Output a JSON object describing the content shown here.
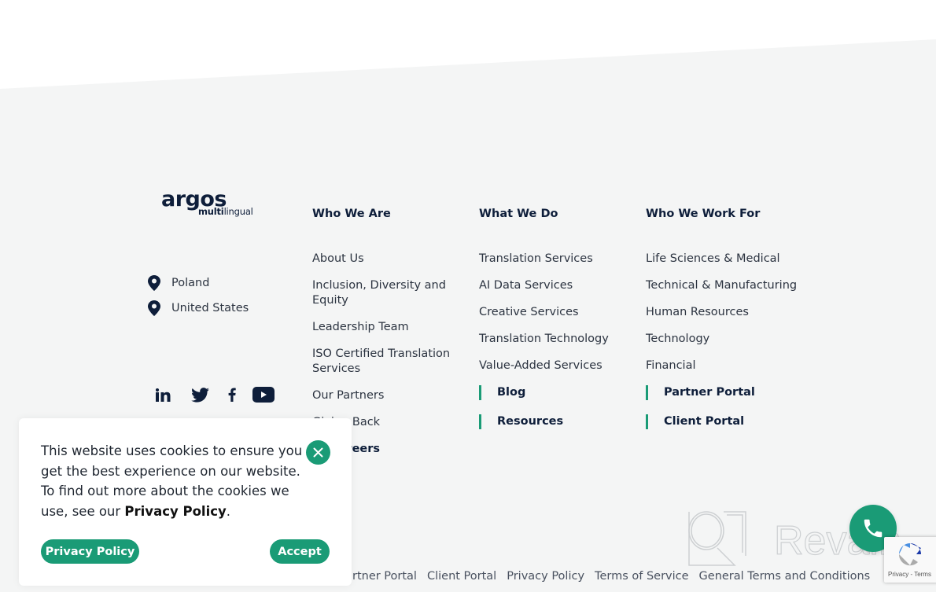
{
  "colors": {
    "accent": "#1a9b76",
    "navy": "#0e1e3a",
    "footer_bg": "#f4f5f5",
    "text": "#2b3340"
  },
  "logo": {
    "word": "argos",
    "sub_bold": "multi",
    "sub_rest": "lingual"
  },
  "locations": [
    {
      "icon": "map-pin-icon",
      "label": "Poland"
    },
    {
      "icon": "map-pin-icon",
      "label": "United States"
    }
  ],
  "socials": [
    {
      "icon": "linkedin-icon",
      "label": "LinkedIn"
    },
    {
      "icon": "twitter-icon",
      "label": "Twitter"
    },
    {
      "icon": "facebook-icon",
      "label": "Facebook"
    },
    {
      "icon": "youtube-icon",
      "label": "YouTube"
    }
  ],
  "columns": {
    "who_we_are": {
      "title": "Who We Are",
      "items": [
        "About Us",
        "Inclusion, Diversity and Equity",
        "Leadership Team",
        "ISO Certified Translation Services",
        "Our Partners",
        "Giving Back"
      ],
      "highlight": [
        "Careers"
      ]
    },
    "what_we_do": {
      "title": "What We Do",
      "items": [
        "Translation Services",
        "AI Data Services",
        "Creative Services",
        "Translation Technology",
        "Value-Added Services"
      ],
      "highlight": [
        "Blog",
        "Resources"
      ]
    },
    "who_we_work_for": {
      "title": "Who We Work For",
      "items": [
        "Life Sciences & Medical",
        "Technical & Manufacturing",
        "Human Resources",
        "Technology",
        "Financial"
      ],
      "highlight": [
        "Partner Portal",
        "Client Portal"
      ]
    }
  },
  "bottom_links": [
    "Partner Portal",
    "Client Portal",
    "Privacy Policy",
    "Terms of Service",
    "General Terms and Conditions"
  ],
  "cookie_banner": {
    "message": "This website uses cookies to ensure you get the best experience on our website. To find out more about the cookies we use, see our ",
    "policy_link": "Privacy Policy",
    "period": ".",
    "privacy_button": "Privacy Policy",
    "accept_button": "Accept",
    "close_icon": "close-icon"
  },
  "watermark": {
    "text": "Revain"
  },
  "recaptcha": {
    "text": "Privacy - Terms"
  }
}
